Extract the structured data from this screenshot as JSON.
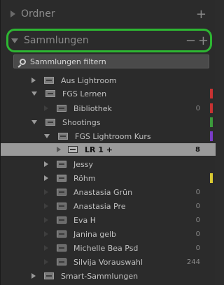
{
  "panel": {
    "ordner_title": "Ordner",
    "ordner_plus": "+",
    "sammlungen_title": "Sammlungen",
    "sammlungen_minus": "−",
    "sammlungen_plus": "+",
    "filter_label": "Sammlungen filtern"
  },
  "rows": [
    {
      "label": "Aus Lightroom",
      "count": "",
      "mark": ""
    },
    {
      "label": "FGS Lernen",
      "count": "",
      "mark": "#c83232"
    },
    {
      "label": "Bibliothek",
      "count": "0",
      "mark": "#c83232"
    },
    {
      "label": "Shootings",
      "count": "",
      "mark": "#3c9a3c"
    },
    {
      "label": "FGS Lightroom Kurs",
      "count": "",
      "mark": "#7a3cc8"
    },
    {
      "label": "LR 1 +",
      "count": "8",
      "mark": ""
    },
    {
      "label": "Jessy",
      "count": "",
      "mark": ""
    },
    {
      "label": "Röhm",
      "count": "",
      "mark": "#d8c832"
    },
    {
      "label": "Anastasia Grün",
      "count": "0",
      "mark": ""
    },
    {
      "label": "Anastasia Pre",
      "count": "0",
      "mark": ""
    },
    {
      "label": "Eva H",
      "count": "0",
      "mark": ""
    },
    {
      "label": "Janina gelb",
      "count": "0",
      "mark": ""
    },
    {
      "label": "Michelle Bea Psd",
      "count": "0",
      "mark": ""
    },
    {
      "label": "Silvija Vorauswahl",
      "count": "244",
      "mark": ""
    },
    {
      "label": "Smart-Sammlungen",
      "count": "",
      "mark": ""
    }
  ]
}
